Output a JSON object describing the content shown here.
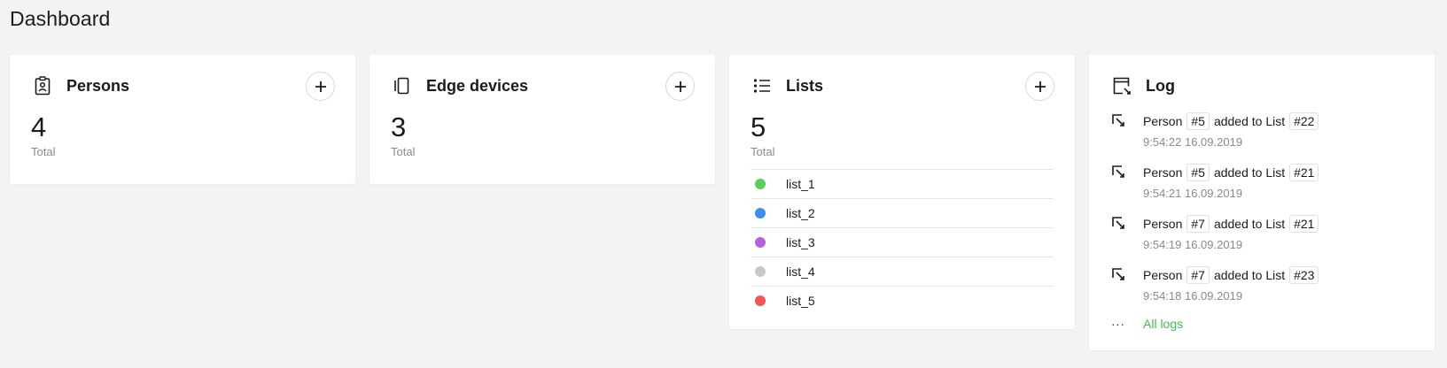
{
  "page": {
    "title": "Dashboard"
  },
  "persons": {
    "title": "Persons",
    "total_value": "4",
    "total_label": "Total",
    "add_label": "+"
  },
  "edge_devices": {
    "title": "Edge devices",
    "total_value": "3",
    "total_label": "Total",
    "add_label": "+"
  },
  "lists": {
    "title": "Lists",
    "total_value": "5",
    "total_label": "Total",
    "add_label": "+",
    "items": [
      {
        "name": "list_1",
        "color": "#5bcd5a"
      },
      {
        "name": "list_2",
        "color": "#3d8ee8"
      },
      {
        "name": "list_3",
        "color": "#b363d9"
      },
      {
        "name": "list_4",
        "color": "#c8c8c8"
      },
      {
        "name": "list_5",
        "color": "#f15555"
      }
    ]
  },
  "log": {
    "title": "Log",
    "entries": [
      {
        "subject": "Person",
        "subject_id": "#5",
        "action": "added to List",
        "target_id": "#22",
        "time": "9:54:22 16.09.2019"
      },
      {
        "subject": "Person",
        "subject_id": "#5",
        "action": "added to List",
        "target_id": "#21",
        "time": "9:54:21 16.09.2019"
      },
      {
        "subject": "Person",
        "subject_id": "#7",
        "action": "added to List",
        "target_id": "#21",
        "time": "9:54:19 16.09.2019"
      },
      {
        "subject": "Person",
        "subject_id": "#7",
        "action": "added to List",
        "target_id": "#23",
        "time": "9:54:18 16.09.2019"
      }
    ],
    "more_ellipsis": "···",
    "all_logs_label": "All logs"
  }
}
